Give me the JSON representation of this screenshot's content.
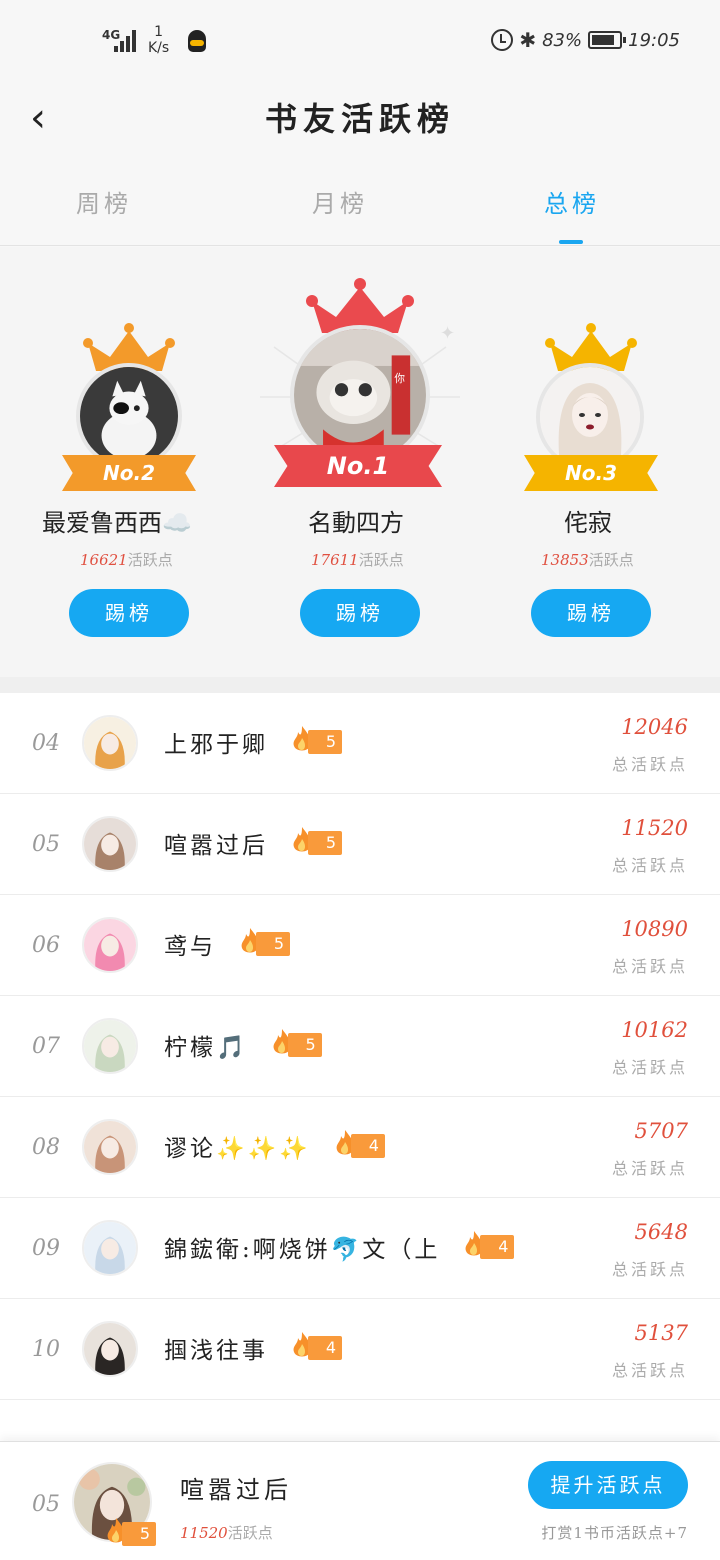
{
  "status_bar": {
    "network": "4G",
    "speed_value": "1",
    "speed_unit": "K/s",
    "battery": "83%",
    "battery_level": 0.83,
    "time": "19:05"
  },
  "header": {
    "title": "书友活跃榜"
  },
  "tabs": [
    {
      "label": "周榜",
      "active": false
    },
    {
      "label": "月榜",
      "active": false
    },
    {
      "label": "总榜",
      "active": true
    }
  ],
  "podium": {
    "first": {
      "badge": "No.1",
      "name": "名動四方",
      "points": "17611",
      "points_unit": "活跃点",
      "button": "踢榜"
    },
    "second": {
      "badge": "No.2",
      "name": "最爱鲁西西☁️",
      "points": "16621",
      "points_unit": "活跃点",
      "button": "踢榜"
    },
    "third": {
      "badge": "No.3",
      "name": "侘寂",
      "points": "13853",
      "points_unit": "活跃点",
      "button": "踢榜"
    }
  },
  "list": [
    {
      "rank": "04",
      "name": "上邪于卿",
      "level": "5",
      "points": "12046",
      "label": "总活跃点"
    },
    {
      "rank": "05",
      "name": "喧嚣过后",
      "level": "5",
      "points": "11520",
      "label": "总活跃点"
    },
    {
      "rank": "06",
      "name": "鸢与",
      "level": "5",
      "points": "10890",
      "label": "总活跃点"
    },
    {
      "rank": "07",
      "name": "柠檬🎵",
      "level": "5",
      "points": "10162",
      "label": "总活跃点"
    },
    {
      "rank": "08",
      "name": "谬论✨✨✨",
      "level": "4",
      "points": "5707",
      "label": "总活跃点"
    },
    {
      "rank": "09",
      "name": "錦鋐衛:啊烧饼🐬文（上",
      "level": "4",
      "points": "5648",
      "label": "总活跃点"
    },
    {
      "rank": "10",
      "name": "掴浅往事",
      "level": "4",
      "points": "5137",
      "label": "总活跃点"
    }
  ],
  "me": {
    "rank": "05",
    "name": "喧嚣过后",
    "level": "5",
    "points": "11520",
    "points_unit": "活跃点",
    "boost_button": "提升活跃点",
    "hint": "打赏1书币活跃点+7"
  },
  "colors": {
    "accent": "#16a8f2",
    "points_red": "#e0503c",
    "gold": "#f5b400",
    "silver_orange": "#f39a2a",
    "first_red": "#e8484c",
    "level_orange": "#f99a3b"
  }
}
